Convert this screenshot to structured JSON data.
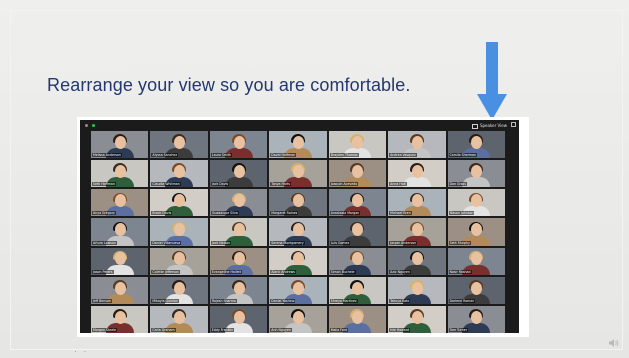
{
  "slide": {
    "title": "Rearrange your view so you are comfortable.",
    "footer_fragment": "· ·"
  },
  "colors": {
    "title": "#24386f",
    "arrow": "#4a90e2",
    "screen_bg": "#1b1b1b",
    "active_dot": "#27c84a"
  },
  "zoom": {
    "view_button": "Speaker View",
    "fullscreen_icon": "fullscreen-icon",
    "participants": [
      "Melissa Anderson",
      "Alyssa Sanchez",
      "Laura Smith",
      "David Hoffman",
      "Brayden Thomas",
      "Andrea Vasquez",
      "Camila Sherman",
      "Seth Hoffman",
      "Claudia Whitman",
      "Jack Davis",
      "Tanya Harts",
      "Joaquin Acevedo",
      "Anna Holt",
      "Dan Gross",
      "Anya Gregory",
      "Brock Davis",
      "Guadalupe Silva",
      "Margaret Raines",
      "Anastasia Morgan",
      "Michael Bren",
      "Mason Johnson",
      "Arturo Lawson",
      "Daniel Villanueva",
      "Jack Nelson",
      "Serena Montgomery",
      "Luis Gomez",
      "Jasper Anderson",
      "Seth Murphy",
      "Jason Peters",
      "Colette Jefferson",
      "Evangeline Hallett",
      "Alaric Andrews",
      "Simon Buchele",
      "Aziz Nguyen",
      "Nasir Rashad",
      "Jeff Benson",
      "Mikayla Quinlan",
      "Rajesh Sharma",
      "Daniel Yoshino",
      "Shreya Martinez",
      "Takuya Kato",
      "Darlene Roman",
      "Morgan Steele",
      "Carla Graham",
      "Eddy Franklin",
      "Anh Nguyen",
      "Malia Ford",
      "Ivie Howard",
      "Tom Turner"
    ]
  }
}
